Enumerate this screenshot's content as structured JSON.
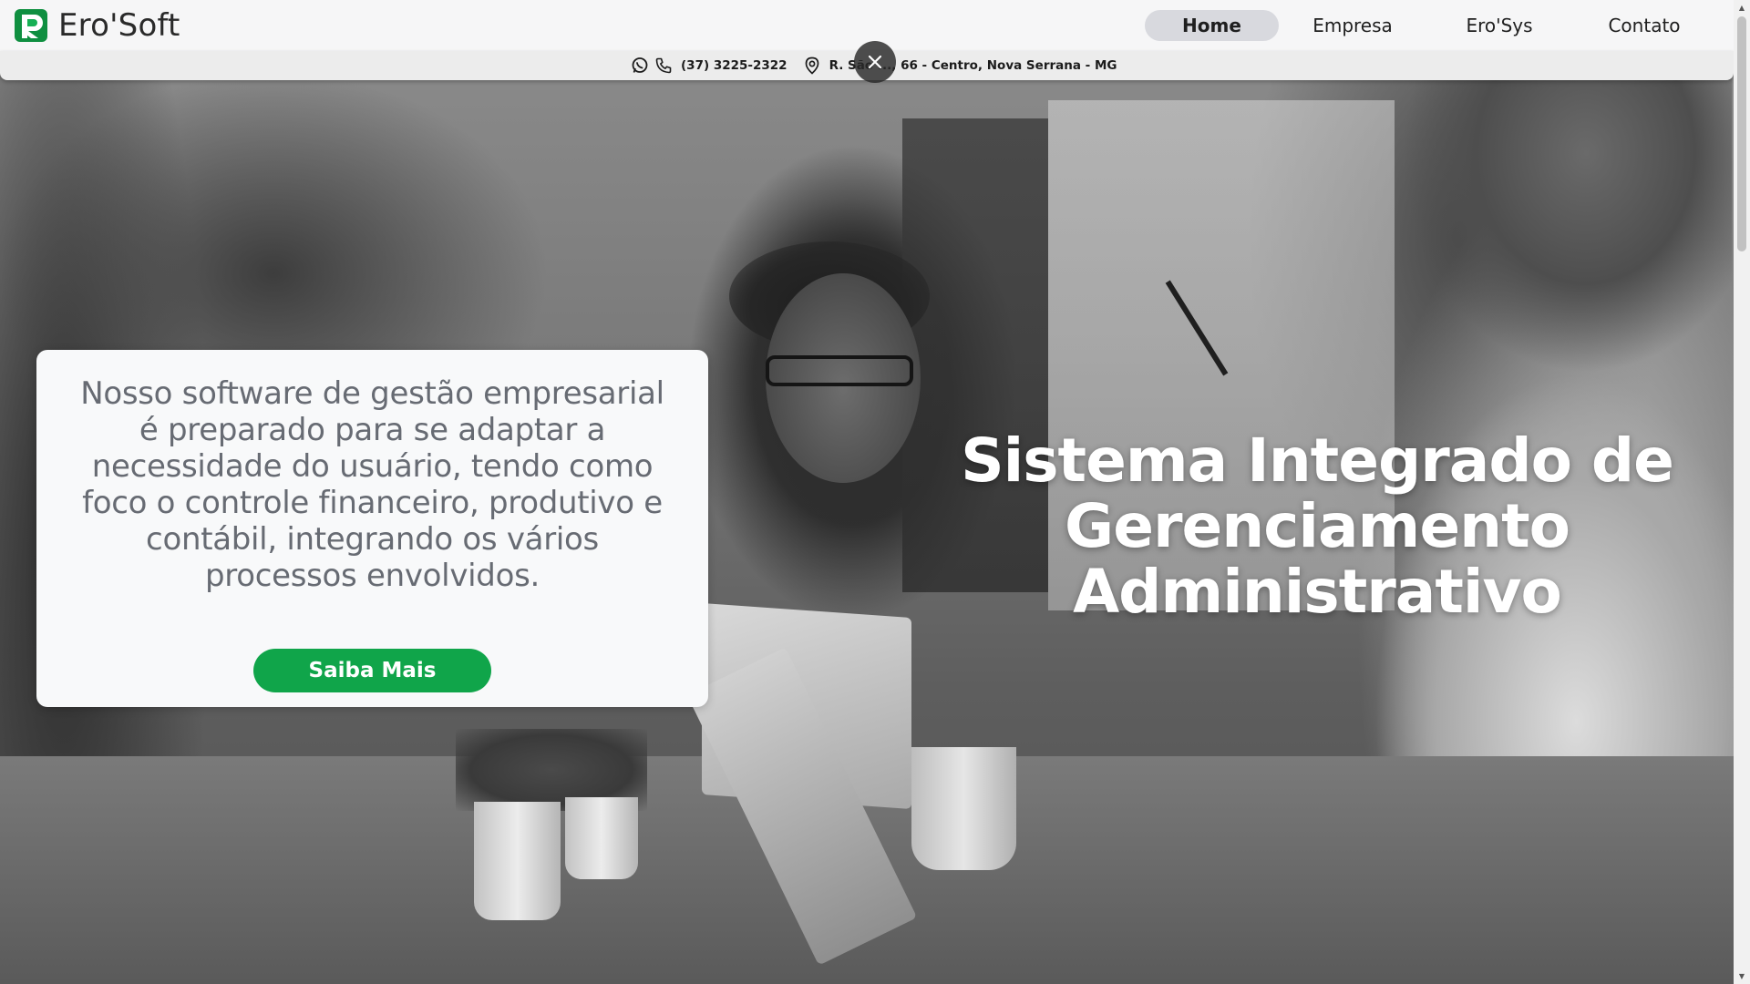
{
  "brand": {
    "name": "Ero'Soft",
    "logo_color": "#12a54d"
  },
  "nav": {
    "items": [
      {
        "label": "Home",
        "active": true
      },
      {
        "label": "Empresa",
        "active": false
      },
      {
        "label": "Ero'Sys",
        "active": false
      },
      {
        "label": "Contato",
        "active": false
      }
    ]
  },
  "contact": {
    "phone": "(37) 3225-2322",
    "address": "R. São ..., 66 - Centro, Nova Serrana - MG",
    "icons": [
      "whatsapp-icon",
      "phone-icon",
      "location-pin-icon"
    ]
  },
  "hero": {
    "card_text": "Nosso software de gestão empresarial é preparado para se adaptar a necessidade do usuário, tendo como foco o controle financeiro, produtivo e contábil, integrando os vários processos envolvidos.",
    "cta_label": "Saiba Mais",
    "headline": [
      "Sistema Integrado de",
      "Gerenciamento",
      "Administrativo"
    ]
  },
  "colors": {
    "accent": "#10a54a",
    "nav_active_bg": "#d8d9de",
    "card_text": "#676b73"
  }
}
